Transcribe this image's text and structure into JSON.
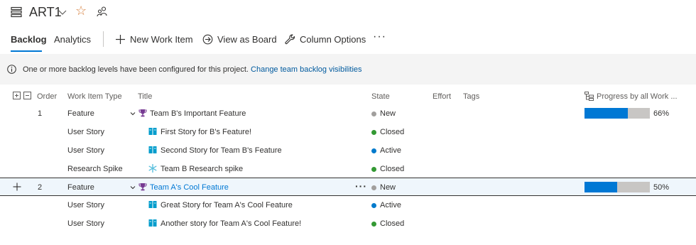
{
  "header": {
    "title": "ART1",
    "star_color": "#d67f3c"
  },
  "tabs": [
    {
      "label": "Backlog",
      "active": true
    },
    {
      "label": "Analytics",
      "active": false
    }
  ],
  "commands": {
    "new_work_item": "New Work Item",
    "view_as_board": "View as Board",
    "column_options": "Column Options",
    "more": "···"
  },
  "banner": {
    "message": "One or more backlog levels have been configured for this project.",
    "link": "Change team backlog visibilities"
  },
  "columns": {
    "order": "Order",
    "type": "Work Item Type",
    "title": "Title",
    "state": "State",
    "effort": "Effort",
    "tags": "Tags",
    "progress": "Progress by all Work ..."
  },
  "rows": [
    {
      "order": "1",
      "type": "Feature",
      "title": "Team B's Important Feature",
      "icon": "trophy-icon",
      "state": "New",
      "state_color": "#a19f9d",
      "progress_fraction": 0.66,
      "progress_label": "66%"
    },
    {
      "order": "",
      "type": "User Story",
      "title": "First Story for B's Feature!",
      "icon": "book-icon",
      "state": "Closed",
      "state_color": "#339933"
    },
    {
      "order": "",
      "type": "User Story",
      "title": "Second Story for Team B's Feature",
      "icon": "book-icon",
      "state": "Active",
      "state_color": "#007acc"
    },
    {
      "order": "",
      "type": "Research Spike",
      "title": "Team B Research spike",
      "icon": "snowflake-icon",
      "state": "Closed",
      "state_color": "#339933"
    },
    {
      "order": "2",
      "type": "Feature",
      "title": "Team A's Cool Feature",
      "icon": "trophy-icon",
      "state": "New",
      "state_color": "#a19f9d",
      "progress_fraction": 0.5,
      "progress_label": "50%",
      "selected": true
    },
    {
      "order": "",
      "type": "User Story",
      "title": "Great Story for Team A's Cool Feature",
      "icon": "book-icon",
      "state": "Active",
      "state_color": "#007acc"
    },
    {
      "order": "",
      "type": "User Story",
      "title": "Another story for Team A's Cool Feature!",
      "icon": "book-icon",
      "state": "Closed",
      "state_color": "#339933"
    }
  ],
  "colors": {
    "accent": "#0078d4",
    "trophy": "#773b93",
    "book": "#009ccc",
    "spike": "#5bc0de"
  }
}
